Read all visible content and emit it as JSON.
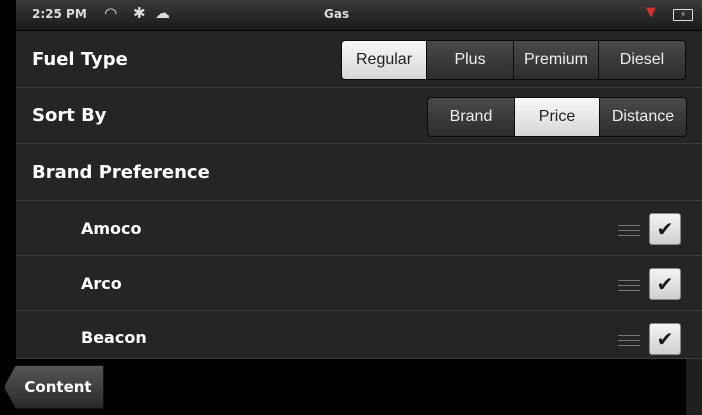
{
  "status_bar": {
    "time": "2:25 PM",
    "title": "Gas",
    "icons": [
      "wifi-icon",
      "bluetooth-icon",
      "cloud-sync-icon",
      "signal-icon",
      "battery-icon"
    ]
  },
  "fuel_type": {
    "label": "Fuel Type",
    "options": [
      "Regular",
      "Plus",
      "Premium",
      "Diesel"
    ],
    "selected": "Regular"
  },
  "sort_by": {
    "label": "Sort By",
    "options": [
      "Brand",
      "Price",
      "Distance"
    ],
    "selected": "Price"
  },
  "brand_preference": {
    "label": "Brand Preference",
    "brands": [
      {
        "name": "Amoco",
        "checked": true
      },
      {
        "name": "Arco",
        "checked": true
      },
      {
        "name": "Beacon",
        "checked": true
      }
    ]
  },
  "footer": {
    "content_label": "Content"
  }
}
